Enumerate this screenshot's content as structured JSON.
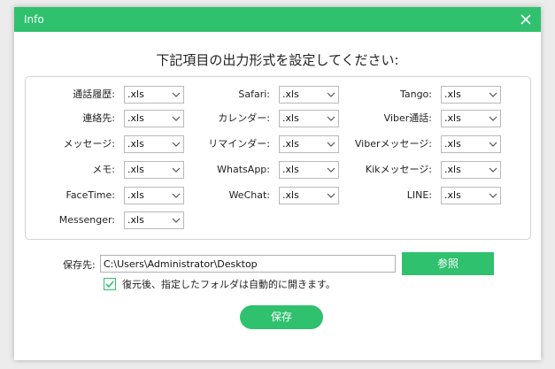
{
  "window": {
    "title": "Info",
    "close_label": "close"
  },
  "heading": "下記項目の出力形式を設定してください:",
  "fields": [
    {
      "label": "通話履歴:",
      "value": ".xls"
    },
    {
      "label": "Safari:",
      "value": ".xls"
    },
    {
      "label": "Tango:",
      "value": ".xls"
    },
    {
      "label": "連絡先:",
      "value": ".xls"
    },
    {
      "label": "カレンダー:",
      "value": ".xls"
    },
    {
      "label": "Viber通話:",
      "value": ".xls"
    },
    {
      "label": "メッセージ:",
      "value": ".xls"
    },
    {
      "label": "リマインダー:",
      "value": ".xls"
    },
    {
      "label": "Viberメッセージ:",
      "value": ".xls"
    },
    {
      "label": "メモ:",
      "value": ".xls"
    },
    {
      "label": "WhatsApp:",
      "value": ".xls"
    },
    {
      "label": "Kikメッセージ:",
      "value": ".xls"
    },
    {
      "label": "FaceTime:",
      "value": ".xls"
    },
    {
      "label": "WeChat:",
      "value": ".xls"
    },
    {
      "label": "LINE:",
      "value": ".xls"
    },
    {
      "label": "Messenger:",
      "value": ".xls"
    }
  ],
  "save_location": {
    "label": "保存先:",
    "path": "C:\\Users\\Administrator\\Desktop",
    "browse_label": "参照"
  },
  "open_folder": {
    "checked": true,
    "label": "復元後、指定したフォルダは自動的に開きます。"
  },
  "save_button": "保存",
  "colors": {
    "accent": "#2fc16e",
    "border": "#d4d4d4"
  }
}
